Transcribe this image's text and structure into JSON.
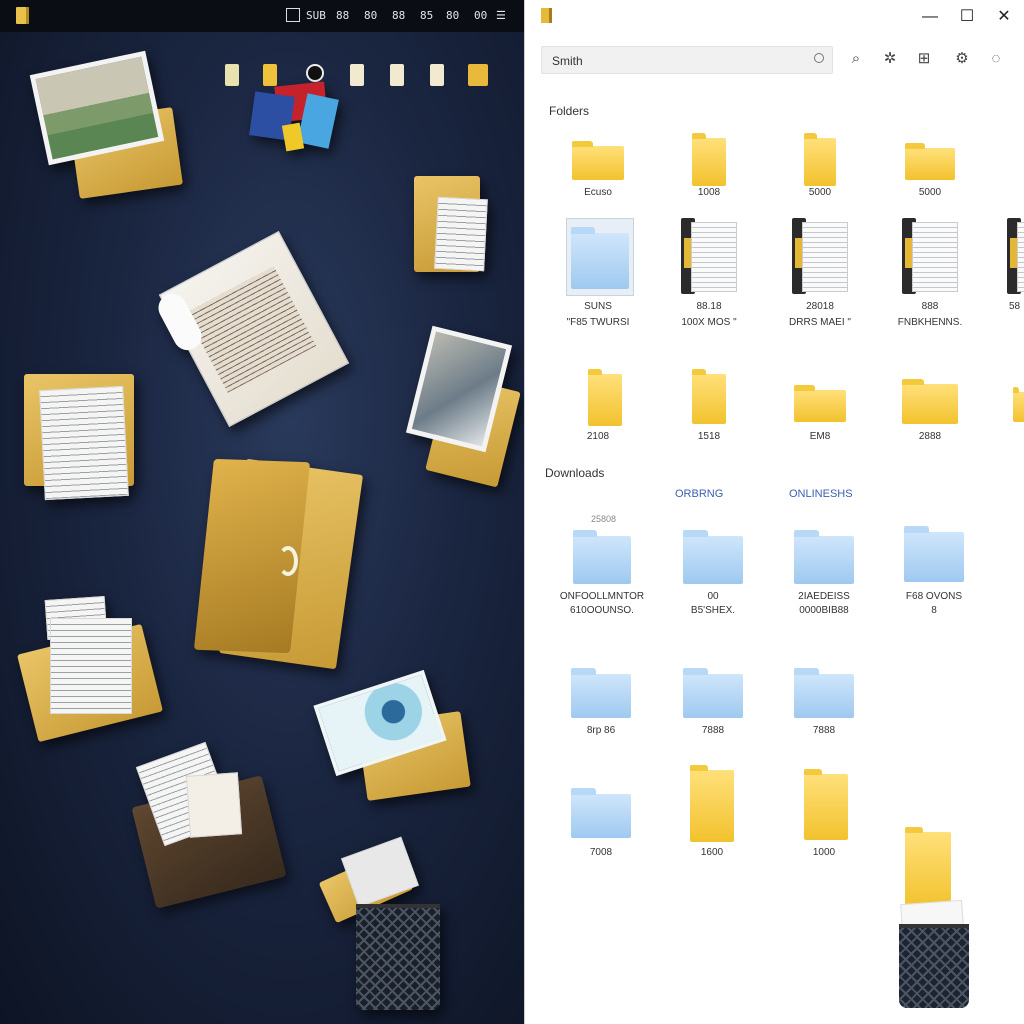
{
  "taskbar": {
    "tray": [
      "SUB",
      "88",
      "80",
      "88",
      "85",
      "80",
      "00"
    ],
    "tray_end": "☰"
  },
  "window": {
    "minimize": "—",
    "maximize": "☐",
    "close": "✕"
  },
  "search": {
    "value": "Smith"
  },
  "toolbar_icons": [
    "magnify-icon",
    "bug-icon",
    "translate-icon",
    "settings-icon",
    "refresh-icon"
  ],
  "sections": {
    "first": "Folders",
    "second": "Downloads",
    "tab_a": "ORBRNG",
    "tab_b": "ONLINESHS",
    "sub_label": "25808"
  },
  "row1": [
    "Ecuso",
    "1008",
    "5000",
    "5000"
  ],
  "row2": [
    {
      "a": "SUNS",
      "b": "\"F85 TWURSI"
    },
    {
      "a": "88.18",
      "b": "100X MOS \""
    },
    {
      "a": "28018",
      "b": "DRRS MAEI \""
    },
    {
      "a": "888",
      "b": "FNBKHENNS."
    },
    {
      "a": "58",
      "b": ""
    }
  ],
  "row3": [
    "2108",
    "1518",
    "EM8",
    "2888"
  ],
  "row4": [
    {
      "a": "ONFOOLLMNTOR",
      "b": "610OOUNSO."
    },
    {
      "a": "00",
      "b": "B5'SHEX."
    },
    {
      "a": "2IAEDEISS",
      "b": "0000BIB88"
    },
    {
      "a": "F68 OVONS",
      "b": "8"
    }
  ],
  "row5": [
    "8rp 86",
    "7888",
    "7888"
  ],
  "row6": [
    "7008",
    "1600",
    "1000"
  ]
}
